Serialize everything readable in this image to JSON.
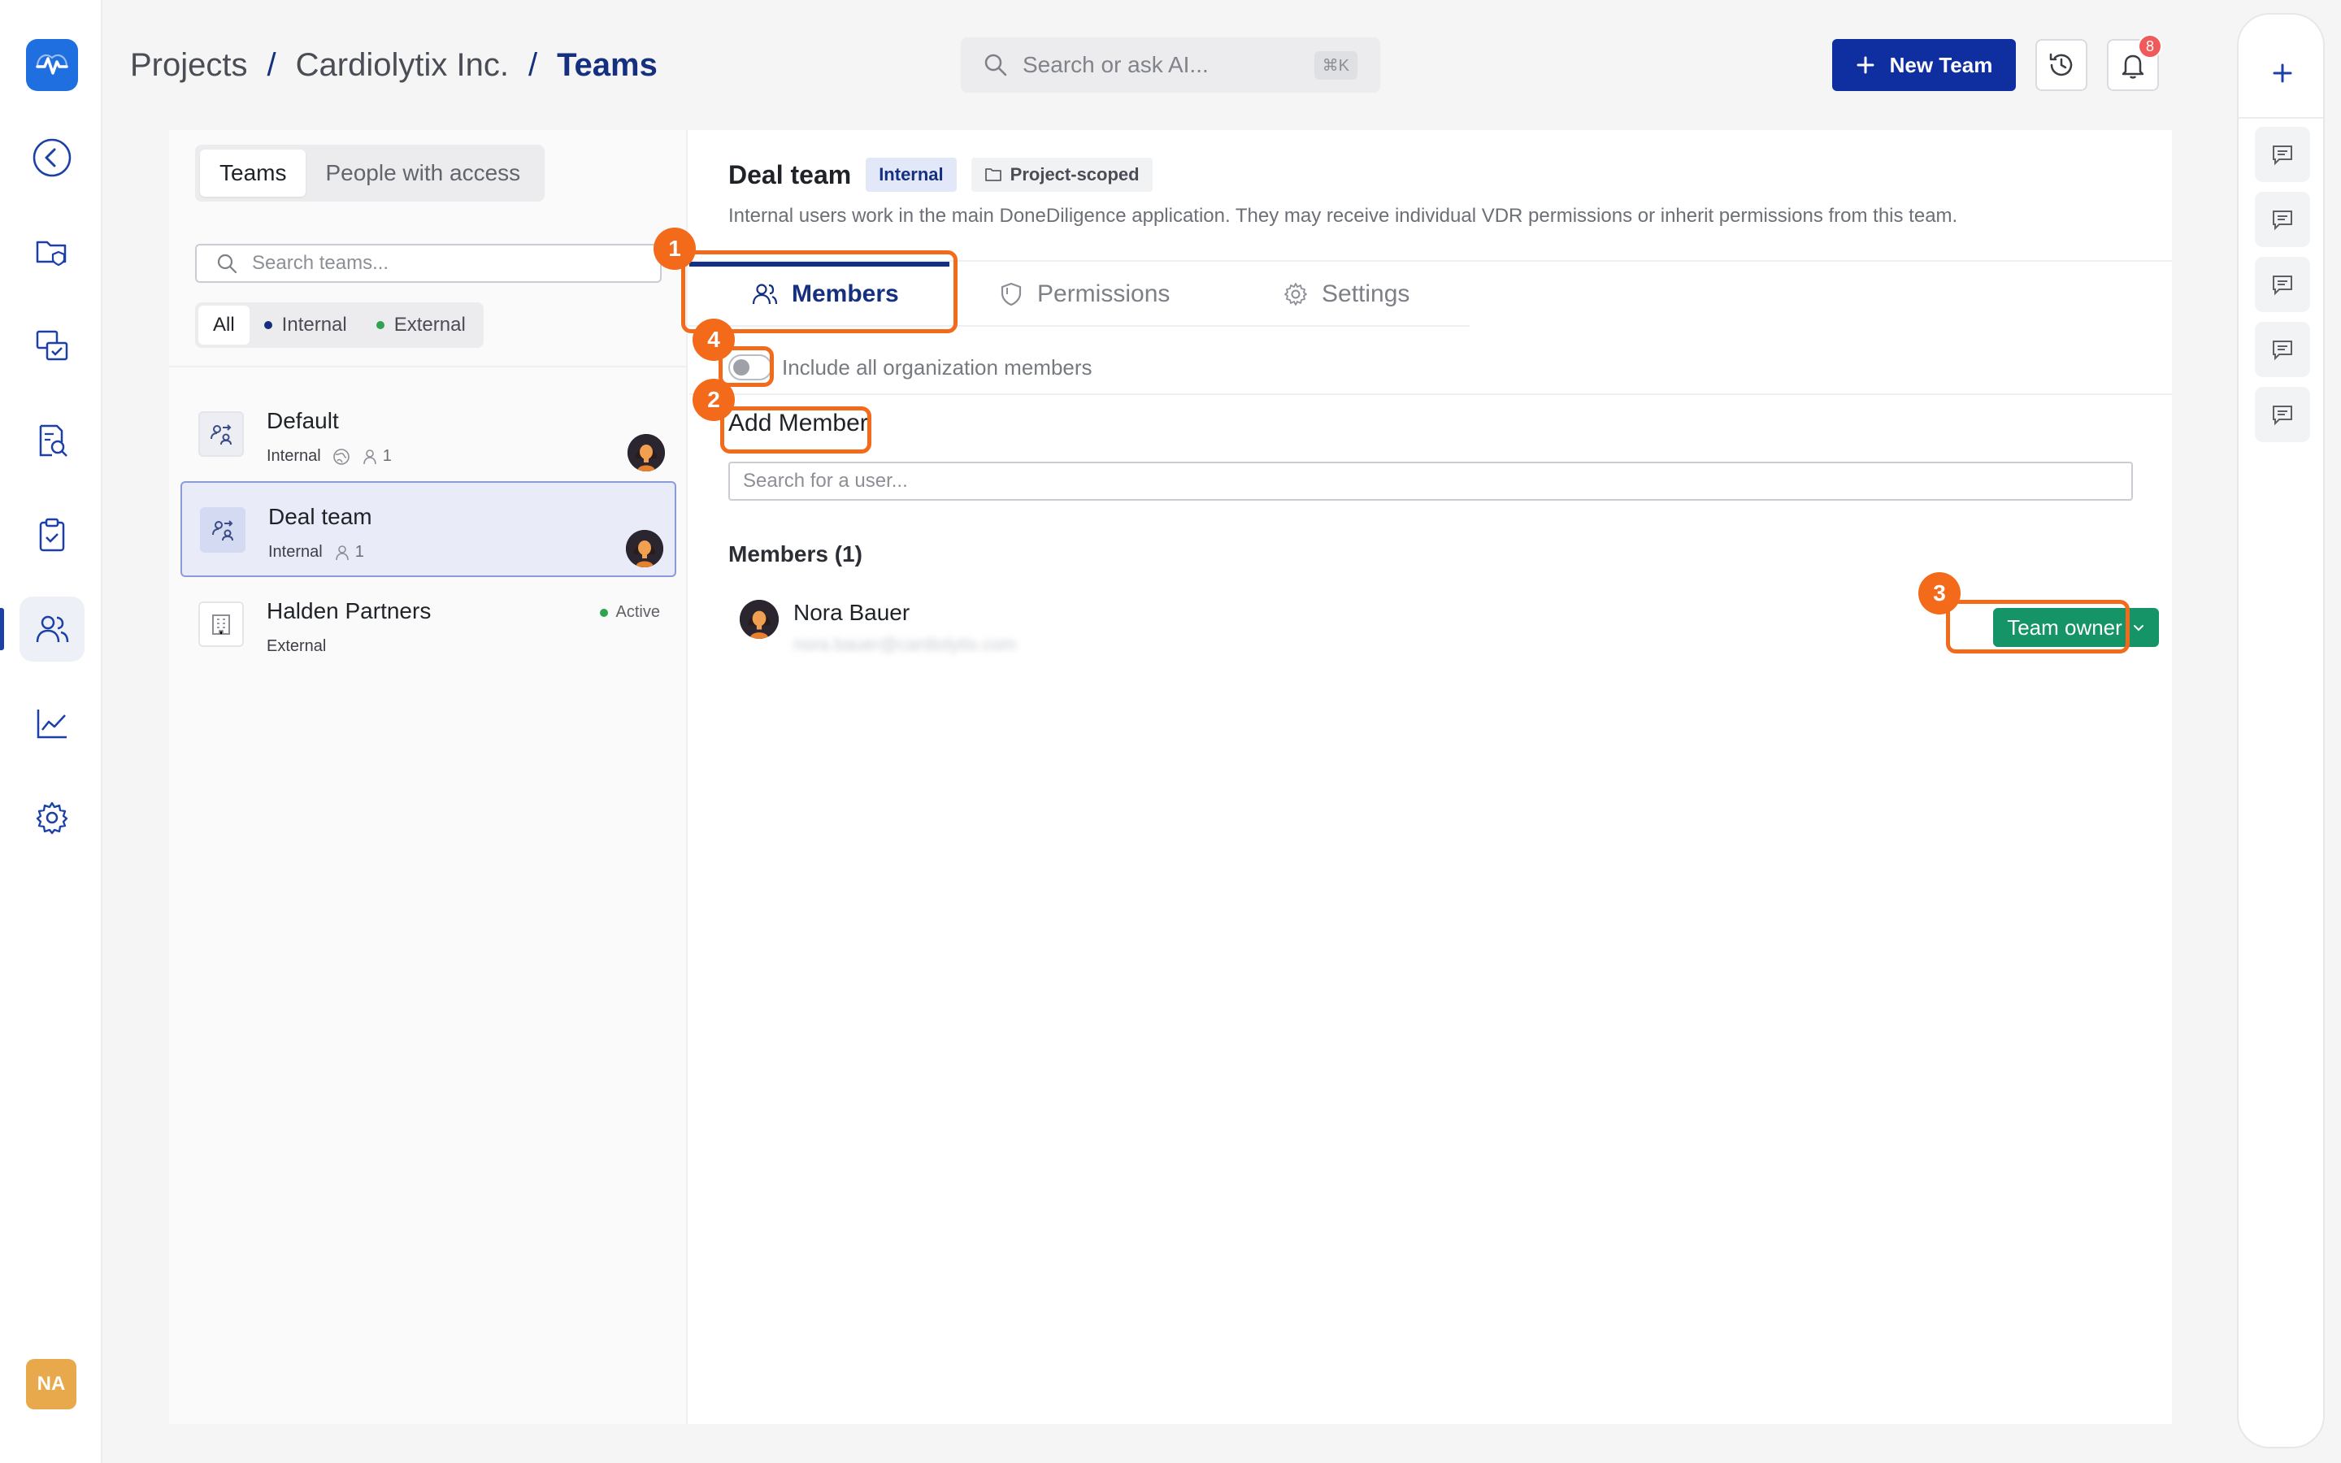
{
  "breadcrumb": [
    "Projects",
    "Cardiolytix Inc.",
    "Teams"
  ],
  "breadcrumb_sep": "/",
  "search": {
    "placeholder": "Search or ask AI...",
    "shortcut": "⌘K"
  },
  "header": {
    "new_team_label": "New Team",
    "notification_count": "8"
  },
  "user": {
    "initials": "NA"
  },
  "sidebar": {
    "items": [
      {
        "name": "back",
        "icon": "chevron-left-icon"
      },
      {
        "name": "data-room",
        "icon": "folder-shield-icon"
      },
      {
        "name": "qa",
        "icon": "chat-check-icon"
      },
      {
        "name": "review",
        "icon": "document-search-icon"
      },
      {
        "name": "checklist",
        "icon": "clipboard-check-icon"
      },
      {
        "name": "teams",
        "icon": "users-icon",
        "active": true
      },
      {
        "name": "analytics",
        "icon": "chart-line-icon"
      },
      {
        "name": "settings",
        "icon": "gear-icon"
      }
    ]
  },
  "teams_panel": {
    "segments": [
      "Teams",
      "People with access"
    ],
    "active_segment": "Teams",
    "search_placeholder": "Search teams...",
    "filters": [
      "All",
      "Internal",
      "External"
    ],
    "active_filter": "All",
    "teams": [
      {
        "name": "Default",
        "type": "Internal",
        "members": "1",
        "has_avatar": true
      },
      {
        "name": "Deal team",
        "type": "Internal",
        "members": "1",
        "selected": true,
        "has_avatar": true
      },
      {
        "name": "Halden Partners",
        "type": "External",
        "status": "Active"
      }
    ]
  },
  "detail": {
    "title": "Deal team",
    "type_badge": "Internal",
    "scope_badge": "Project-scoped",
    "description": "Internal users work in the main DoneDiligence application. They may receive individual VDR permissions or inherit permissions from this team.",
    "tabs": [
      "Members",
      "Permissions",
      "Settings"
    ],
    "active_tab": "Members",
    "toggle_label": "Include all organization members",
    "add_member_label": "Add Member",
    "user_search_placeholder": "Search for a user...",
    "members_heading": "Members (1)",
    "members": [
      {
        "name": "Nora Bauer",
        "email": "nora.bauer@cardiolytix.com",
        "role": "Team owner"
      }
    ]
  },
  "annotations": [
    "1",
    "2",
    "3",
    "4"
  ],
  "colors": {
    "brand": "#1f6fe0",
    "primary": "#0f2fa0",
    "accent_navy": "#15307f",
    "owner_green": "#149467",
    "annotation_orange": "#f36a1a",
    "internal_dot": "#15307f",
    "external_dot": "#2ea44f",
    "notification_red": "#f05a5a"
  }
}
